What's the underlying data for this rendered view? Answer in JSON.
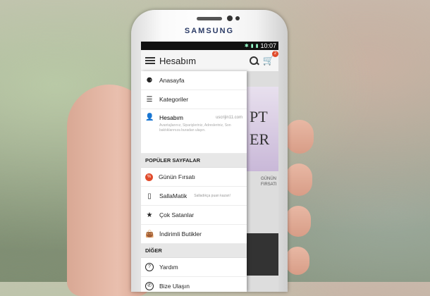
{
  "device": {
    "brand": "SAMSUNG"
  },
  "status_bar": {
    "time": "10:07"
  },
  "app_bar": {
    "title": "Hesabım",
    "cart_count": "2"
  },
  "drawer": {
    "top_items": [
      {
        "label": "Anasayfa",
        "icon": "home-icon"
      },
      {
        "label": "Kategoriler",
        "icon": "list-icon"
      }
    ],
    "account": {
      "label": "Hesabım",
      "email": "uscrijin11.com",
      "subtitle": "Avantajlarınız, Siparişleriniz, Adresleriniz, Son baktıklarınıza buradan ulaşın."
    },
    "popular_header": "POPÜLER SAYFALAR",
    "popular_items": [
      {
        "label": "Günün Fırsatı",
        "icon": "deal-icon"
      },
      {
        "label": "SallaMatik",
        "note": "Salladıkça puan kazan!",
        "icon": "shake-phone-icon"
      },
      {
        "label": "Çok Satanlar",
        "icon": "star-icon"
      },
      {
        "label": "İndirimli Butikler",
        "icon": "shopping-bag-icon"
      }
    ],
    "other_header": "DİĞER",
    "other_items": [
      {
        "label": "Yardım",
        "icon": "help-icon"
      },
      {
        "label": "Bize Ulaşın",
        "icon": "phone-icon"
      }
    ]
  },
  "background_content": {
    "banner_letters_1": "PT",
    "banner_letters_2": "ER",
    "promo_1": "GÜNÜN",
    "promo_2": "FIRSATI"
  },
  "colors": {
    "accent": "#e04a2a"
  }
}
